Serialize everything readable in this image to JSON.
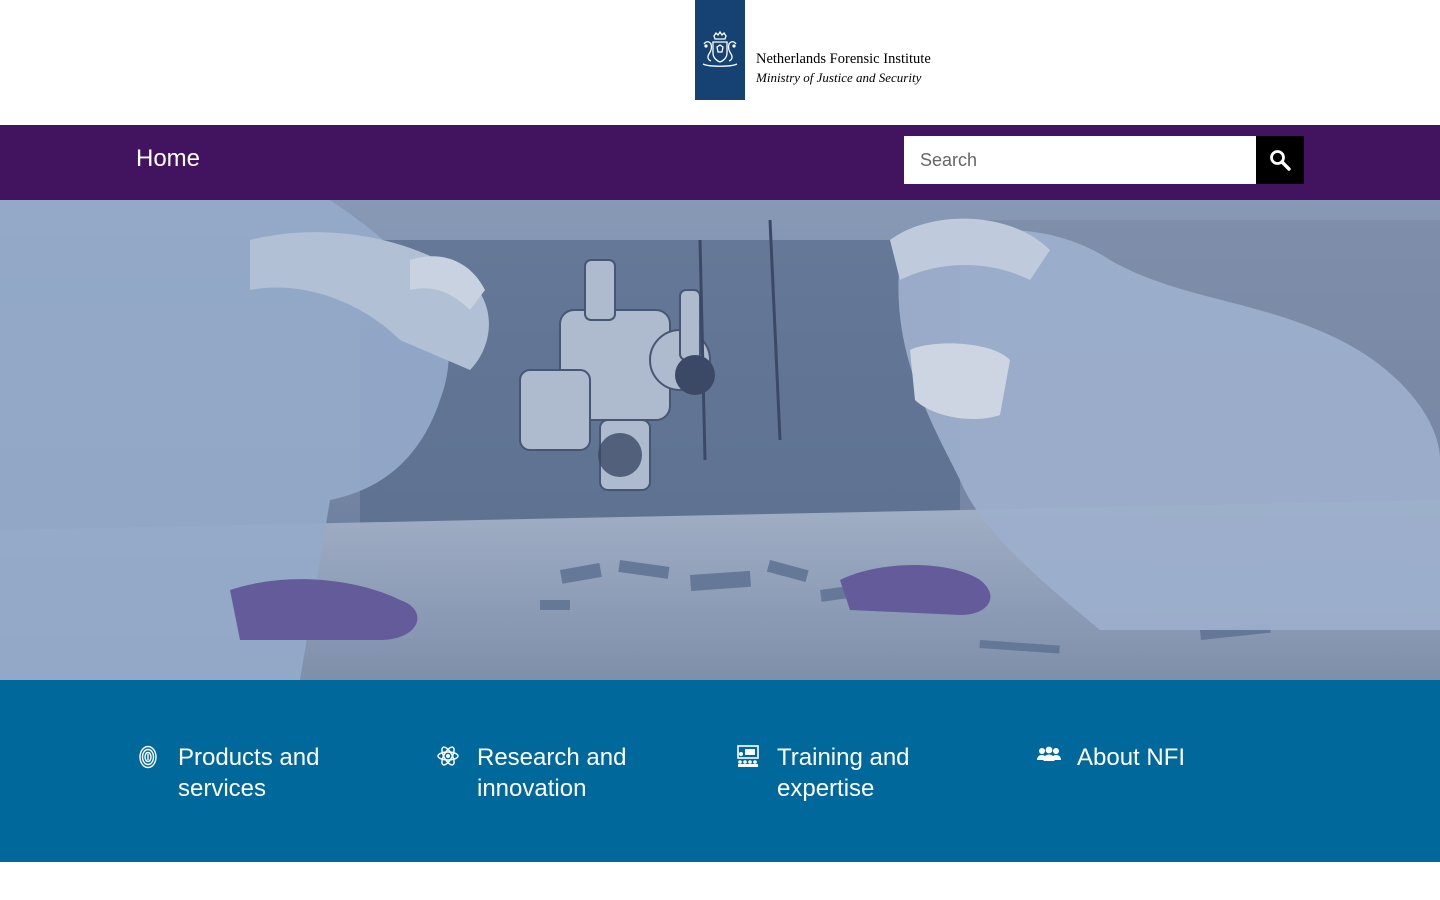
{
  "header": {
    "logo_line1": "Netherlands Forensic Institute",
    "logo_line2": "Ministry of Justice and Security",
    "ribbon_color": "#154273"
  },
  "nav": {
    "home_label": "Home",
    "background": "#42145f"
  },
  "search": {
    "placeholder": "Search",
    "icon": "search-icon"
  },
  "hero": {
    "image": "forensic lab scientists examining objects with microscope"
  },
  "tiles": {
    "background": "#01689b",
    "items": [
      {
        "label": "Products and services",
        "icon": "fingerprint-icon"
      },
      {
        "label": "Research and innovation",
        "icon": "atom-icon"
      },
      {
        "label": "Training and expertise",
        "icon": "training-icon"
      },
      {
        "label": "About NFI",
        "icon": "people-icon"
      }
    ]
  }
}
